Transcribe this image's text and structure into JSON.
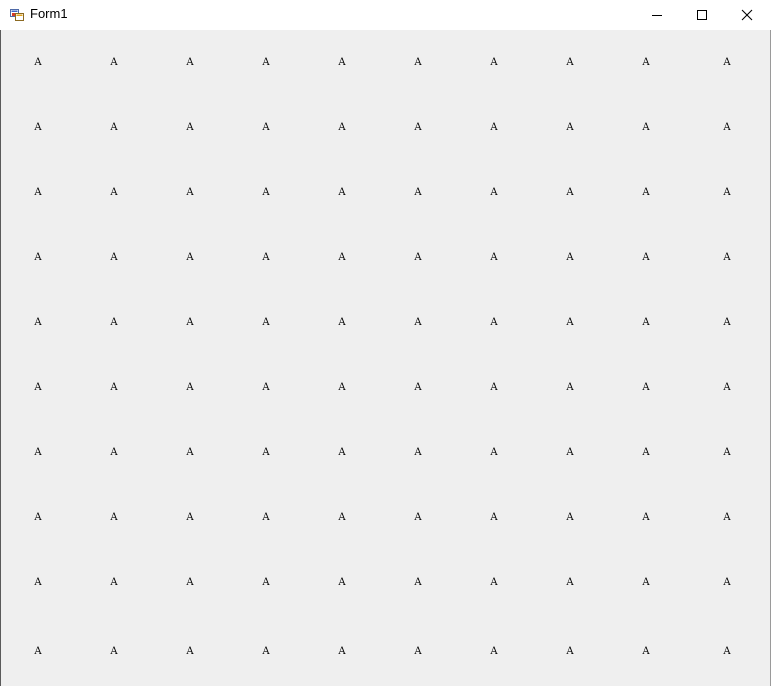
{
  "window": {
    "title": "Form1",
    "icons": {
      "app": "winforms-app-icon",
      "minimize": "minimize-icon",
      "maximize": "maximize-icon",
      "close": "close-icon"
    }
  },
  "grid": {
    "rows": 10,
    "columns": 10,
    "label_text": "A"
  },
  "colors": {
    "titlebar": "#ffffff",
    "client_background": "#efefef",
    "text": "#000000"
  }
}
